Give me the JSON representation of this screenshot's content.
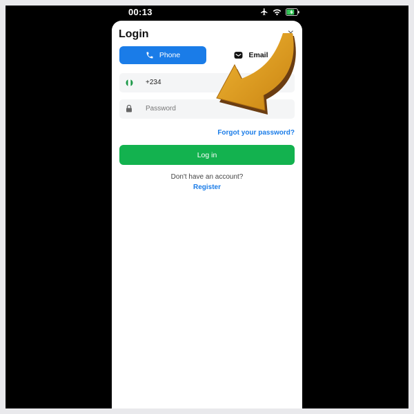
{
  "status_bar": {
    "time": "00:13"
  },
  "login": {
    "title": "Login",
    "close_label": "×",
    "tabs": [
      {
        "label": "Phone",
        "icon": "phone-icon",
        "active": true
      },
      {
        "label": "Email",
        "icon": "envelope-icon",
        "active": false
      }
    ],
    "phone_field": {
      "country_code": "+234",
      "flag": "nigeria-flag-icon"
    },
    "password_field": {
      "placeholder": "Password",
      "icon": "lock-icon"
    },
    "forgot_password": "Forgot your password?",
    "login_button": "Log in",
    "no_account_text": "Don't have an account?",
    "register_link": "Register"
  },
  "colors": {
    "accent_blue": "#1a7ce8",
    "login_green": "#13b24f",
    "arrow_gold": "#d89a1e"
  }
}
